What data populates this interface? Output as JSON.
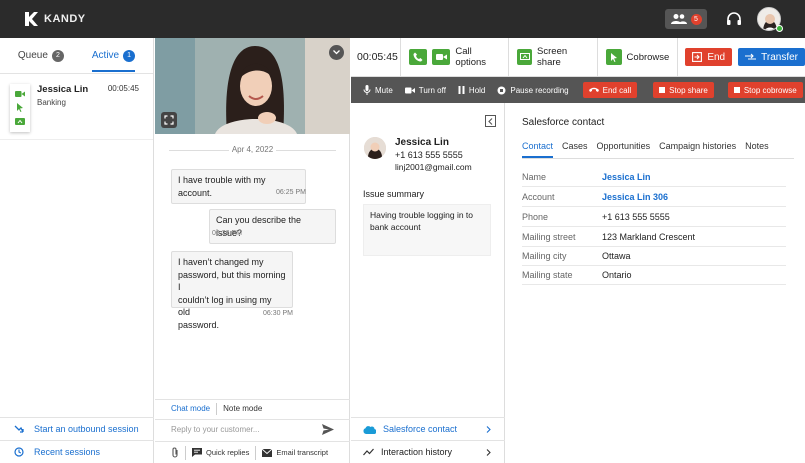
{
  "app": {
    "brand": "KANDY",
    "notification_count": "5"
  },
  "left": {
    "tabs": [
      {
        "label": "Queue",
        "count": "2"
      },
      {
        "label": "Active",
        "count": "1"
      }
    ],
    "session": {
      "name": "Jessica Lin",
      "time": "00:05:45",
      "subject": "Banking"
    },
    "bottom": [
      {
        "label": "Start an outbound session"
      },
      {
        "label": "Recent sessions"
      }
    ]
  },
  "chat": {
    "date": "Apr 4, 2022",
    "messages": [
      {
        "text": "I have trouble with my account.",
        "time": "06:25 PM",
        "from": "customer"
      },
      {
        "text": "Can you describe the issue?",
        "time": "06:26 PM",
        "from": "agent"
      },
      {
        "lines": [
          "I haven’t changed my",
          "password, but this morning I",
          "couldn’t log in using my old",
          "password."
        ],
        "time": "06:30 PM",
        "from": "customer"
      }
    ],
    "modes": [
      "Chat mode",
      "Note mode"
    ],
    "input_placeholder": "Reply to your customer...",
    "tools": [
      "Quick replies",
      "Email transcript"
    ]
  },
  "call": {
    "timer": "00:05:45",
    "call_options": "Call options",
    "screen_share": "Screen share",
    "cobrowse": "Cobrowse",
    "end": "End",
    "transfer": "Transfer"
  },
  "actions": {
    "mute": "Mute",
    "turn_off": "Turn off",
    "hold": "Hold",
    "pause_recording": "Pause recording",
    "end_call": "End call",
    "stop_share": "Stop share",
    "stop_cobrowse": "Stop cobrowse"
  },
  "contact": {
    "name": "Jessica Lin",
    "phone": "+1 613 555 5555",
    "email": "linj2001@gmail.com",
    "issue_title": "Issue summary",
    "issue_text": "Having trouble logging in to bank account",
    "links": [
      "Salesforce contact",
      "Interaction history"
    ]
  },
  "salesforce": {
    "title": "Salesforce contact",
    "tabs": [
      "Contact",
      "Cases",
      "Opportunities",
      "Campaign histories",
      "Notes"
    ],
    "fields": [
      {
        "label": "Name",
        "value": "Jessica Lin"
      },
      {
        "label": "Account",
        "value": "Jessica Lin 306"
      },
      {
        "label": "Phone",
        "value": "+1 613 555 5555"
      },
      {
        "label": "Mailing street",
        "value": "123 Markland Crescent"
      },
      {
        "label": "Mailing city",
        "value": "Ottawa"
      },
      {
        "label": "Mailing state",
        "value": "Ontario"
      }
    ]
  },
  "colors": {
    "topbar": "#2b2b2b",
    "accent_blue": "#1a6fcf",
    "green": "#4aa83a",
    "red": "#e0412d",
    "actionbar": "#555555"
  }
}
